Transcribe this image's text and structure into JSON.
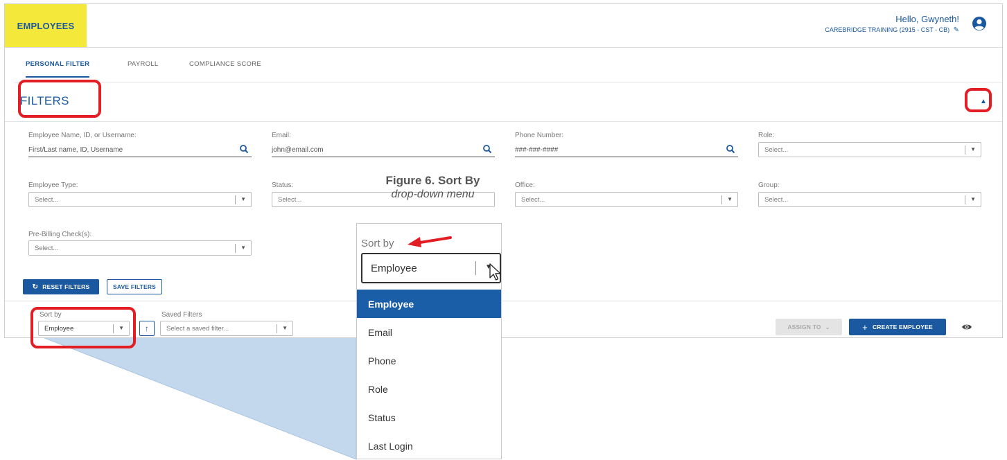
{
  "header": {
    "brand": "EMPLOYEES",
    "greeting": "Hello, Gwyneth!",
    "organization": "CAREBRIDGE TRAINING (2915 - CST - CB)"
  },
  "tabs": [
    {
      "label": "PERSONAL FILTER",
      "active": true
    },
    {
      "label": "PAYROLL",
      "active": false
    },
    {
      "label": "COMPLIANCE SCORE",
      "active": false
    }
  ],
  "filters": {
    "title": "FILTERS",
    "employee_name": {
      "label": "Employee Name, ID, or Username:",
      "placeholder": "First/Last name, ID, Username"
    },
    "email": {
      "label": "Email:",
      "placeholder": "john@email.com"
    },
    "phone": {
      "label": "Phone Number:",
      "placeholder": "###-###-####"
    },
    "role": {
      "label": "Role:",
      "value": "Select..."
    },
    "employee_type": {
      "label": "Employee Type:",
      "value": "Select..."
    },
    "status": {
      "label": "Status:",
      "value": "Select..."
    },
    "office": {
      "label": "Office:",
      "value": "Select..."
    },
    "group": {
      "label": "Group:",
      "value": "Select..."
    },
    "pre_billing": {
      "label": "Pre-Billing Check(s):",
      "value": "Select..."
    },
    "reset_label": "RESET FILTERS",
    "save_label": "SAVE FILTERS"
  },
  "toolbar": {
    "sort_by_label": "Sort by",
    "sort_by_value": "Employee",
    "saved_filters_label": "Saved Filters",
    "saved_filters_placeholder": "Select a saved filter...",
    "assign_to": "ASSIGN TO",
    "create_employee": "CREATE EMPLOYEE"
  },
  "callout": {
    "caption_line1": "Figure 6. Sort By",
    "caption_line2": "drop-down menu",
    "sort_by_label": "Sort by",
    "selected_value": "Employee",
    "options": [
      "Employee",
      "Email",
      "Phone",
      "Role",
      "Status",
      "Last Login"
    ],
    "selected_index": 0
  },
  "colors": {
    "brand_yellow": "#f4e83a",
    "primary_blue": "#1a58a0",
    "highlight_red": "#e21d23",
    "callout_blue": "#bcd4ea"
  },
  "icons": {
    "user": "user-circle-icon",
    "edit": "pencil-icon",
    "search": "search-icon",
    "collapse": "chevron-up-icon",
    "reset": "refresh-icon",
    "sort_direction": "arrow-up-icon",
    "visibility": "eye-icon",
    "add": "plus-icon"
  }
}
